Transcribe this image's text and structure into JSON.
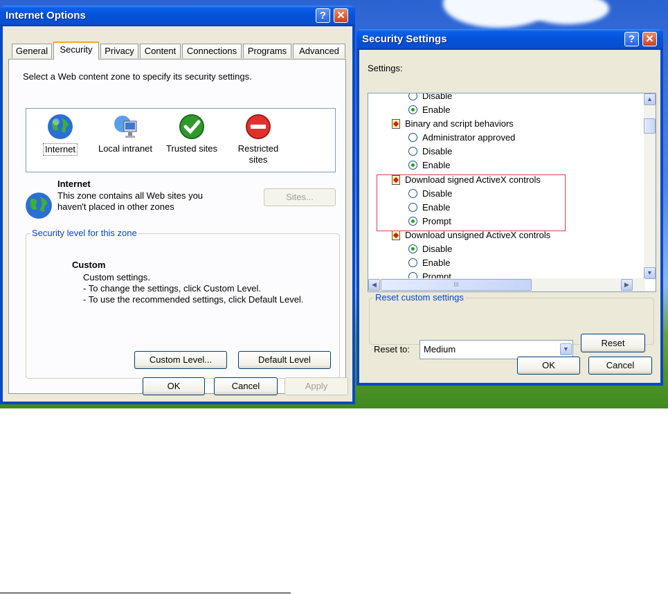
{
  "internet_options": {
    "title": "Internet Options",
    "tabs": [
      "General",
      "Security",
      "Privacy",
      "Content",
      "Connections",
      "Programs",
      "Advanced"
    ],
    "active_tab": "Security",
    "zone_prompt": "Select a Web content zone to specify its security settings.",
    "zones": [
      {
        "label": "Internet",
        "icon": "globe-icon"
      },
      {
        "label": "Local intranet",
        "icon": "intranet-computer-icon"
      },
      {
        "label": "Trusted sites",
        "icon": "checkmark-icon"
      },
      {
        "label": "Restricted\nsites",
        "icon": "no-entry-icon"
      }
    ],
    "selected_zone": {
      "name": "Internet",
      "description_line1": "This zone contains all Web sites you",
      "description_line2": "haven't placed in other zones"
    },
    "sites_button": "Sites...",
    "security_level": {
      "group_label": "Security level for this zone",
      "level_name": "Custom",
      "lines": [
        "Custom settings.",
        "- To change the settings, click Custom Level.",
        "- To use the recommended settings, click Default Level."
      ],
      "custom_level_button": "Custom Level...",
      "default_level_button": "Default Level"
    },
    "ok_button": "OK",
    "cancel_button": "Cancel",
    "apply_button": "Apply"
  },
  "security_settings": {
    "title": "Security Settings",
    "settings_label": "Settings:",
    "items": [
      {
        "type": "radio",
        "label": "Disable",
        "checked": false
      },
      {
        "type": "radio",
        "label": "Enable",
        "checked": true
      },
      {
        "type": "category",
        "label": "Binary and script behaviors"
      },
      {
        "type": "radio",
        "label": "Administrator approved",
        "checked": false
      },
      {
        "type": "radio",
        "label": "Disable",
        "checked": false
      },
      {
        "type": "radio",
        "label": "Enable",
        "checked": true
      },
      {
        "type": "category",
        "label": "Download signed ActiveX controls"
      },
      {
        "type": "radio",
        "label": "Disable",
        "checked": false
      },
      {
        "type": "radio",
        "label": "Enable",
        "checked": false
      },
      {
        "type": "radio",
        "label": "Prompt",
        "checked": true
      },
      {
        "type": "category",
        "label": "Download unsigned ActiveX controls"
      },
      {
        "type": "radio",
        "label": "Disable",
        "checked": true
      },
      {
        "type": "radio",
        "label": "Enable",
        "checked": false
      },
      {
        "type": "radio",
        "label": "Prompt",
        "checked": false
      }
    ],
    "scroll_grip": "III",
    "reset_group_label": "Reset custom settings",
    "reset_to_label": "Reset to:",
    "reset_to_value": "Medium",
    "reset_button": "Reset",
    "ok_button": "OK",
    "cancel_button": "Cancel"
  },
  "colors": {
    "title_bar": "#0352d8",
    "dialog_face": "#ece9d8",
    "group_label": "#0046d5",
    "highlight_border": "#d64040"
  }
}
